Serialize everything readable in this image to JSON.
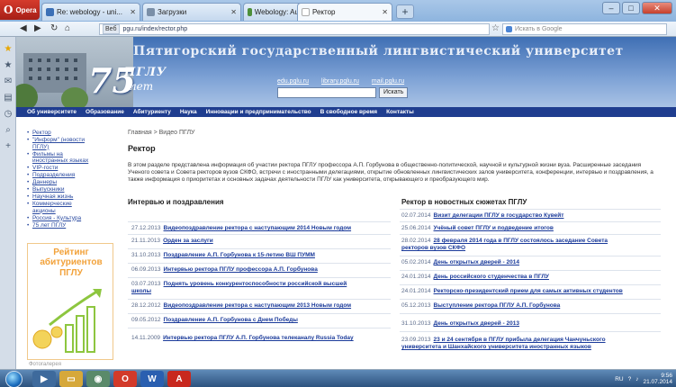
{
  "browser": {
    "app_name": "Opera",
    "tabs": [
      {
        "label": "Re: webology - uni...",
        "color": "#3b6fb6"
      },
      {
        "label": "Загрузки",
        "color": "#7a8fa8"
      },
      {
        "label": "Webology: Author gui...",
        "color": "#4d8f3a"
      },
      {
        "label": "Ректор",
        "color": "#d4d4d4"
      }
    ],
    "address": "pgu.ru/index/rector.php",
    "address_badge": "Веб",
    "search_engine_placeholder": "Искать в Google"
  },
  "site": {
    "title": "Пятигорский государственный лингвистический университет",
    "logo_text": "ПГЛУ",
    "logo_number": "75",
    "logo_sub": "лет",
    "sub_links": [
      "edu.pglu.ru",
      "library.pglu.ru",
      "mail.pglu.ru"
    ],
    "search_button": "Искать",
    "menu": [
      "Об университете",
      "Образование",
      "Абитуриенту",
      "Наука",
      "Инновации и предпринимательство",
      "В свободное время",
      "Контакты"
    ],
    "left_nav": [
      "Ректор",
      "\"Информ\" (новости ПГЛУ)",
      "Фильмы на иностранных языках",
      "VIP-гости",
      "Подразделения",
      "Даннеры",
      "Выпускники",
      "Научная жизнь",
      "Коммерческие акционы",
      "Россия - Культура",
      "75 лет ПГЛУ"
    ],
    "rating_lines": [
      "Рейтинг",
      "абитуриентов",
      "ПГЛУ"
    ],
    "left_footer": "Фотогалерея"
  },
  "content": {
    "breadcrumb": "Главная > Видео ПГЛУ",
    "page_title": "Ректор",
    "intro": "В этом разделе представлена информация об участии ректора ПГЛУ профессора А.П. Горбунова в общественно-политической, научной и культурной жизни вуза. Расширенные заседания Ученого совета и Совета ректоров вузов СКФО, встречи с иностранными делегациями, открытие обновленных лингвистических залов университета, конференции, интервью и поздравления, а также информация о приоритетах и основных задачах деятельности ПГЛУ как университета, открывающего и преобразующего мир.",
    "left_heading": "Интервью и поздравления",
    "right_heading": "Ректор в новостных сюжетах ПГЛУ",
    "left_news": [
      {
        "date": "27.12.2013",
        "title": "Видеопоздравление ректора с наступающим 2014 Новым годом"
      },
      {
        "date": "21.11.2013",
        "title": "Орден за заслуги"
      },
      {
        "date": "31.10.2013",
        "title": "Поздравление А.П. Горбунова к 15-летию ВШ ПУММ"
      },
      {
        "date": "06.09.2013",
        "title": "Интервью ректора ПГЛУ профессора А.П. Горбунова"
      },
      {
        "date": "03.07.2013",
        "title": "Поднять уровень конкурентоспособности российской высшей",
        "title2": "школы"
      },
      {
        "date": "28.12.2012",
        "title": "Видеопоздравление ректора с наступающим 2013 Новым годом"
      },
      {
        "date": "09.05.2012",
        "title": "Поздравление А.П. Горбунова с Днем Победы"
      },
      {
        "date": "14.11.2009",
        "title": "Интервью ректора ПГЛУ А.П. Горбунова телеканалу Russia Today"
      }
    ],
    "right_news": [
      {
        "date": "02.07.2014",
        "title": "Визит делегации ПГЛУ в государство Кувейт"
      },
      {
        "date": "25.06.2014",
        "title": "Учёный совет ПГЛУ и подведение итогов"
      },
      {
        "date": "28.02.2014",
        "title": "28 февраля 2014 года в ПГЛУ состоялось заседание Совета",
        "title2": "ректоров вузов СКФО"
      },
      {
        "date": "05.02.2014",
        "title": "День открытых дверей - 2014"
      },
      {
        "date": "24.01.2014",
        "title": "День российского студенчества в ПГЛУ"
      },
      {
        "date": "24.01.2014",
        "title": "Ректорско-президентский прием для самых активных студентов"
      },
      {
        "date": "05.12.2013",
        "title": "Выступление ректора ПГЛУ А.П. Горбунова"
      },
      {
        "date": "31.10.2013",
        "title": "День открытых дверей - 2013"
      },
      {
        "date": "23.09.2013",
        "title": "23 и 24 сентября в ПГЛУ прибыла делегация Чанчуньского",
        "title2": "университета и Шанхайского университета иностранных языков"
      }
    ]
  },
  "taskbar": {
    "lang": "RU",
    "time": "9:56",
    "date": "21.07.2014"
  }
}
